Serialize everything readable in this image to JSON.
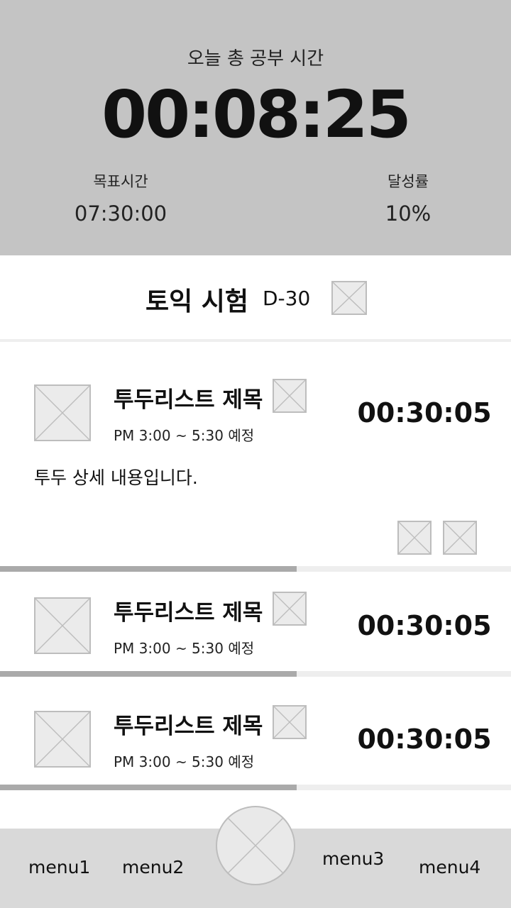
{
  "header": {
    "total_label": "오늘 총 공부 시간",
    "total_time": "00:08:25",
    "goal_label": "목표시간",
    "goal_value": "07:30:00",
    "rate_label": "달성률",
    "rate_value": "10%"
  },
  "exam": {
    "title": "토익 시험",
    "dday": "D-30"
  },
  "todos": [
    {
      "title": "투두리스트 제목",
      "time": "PM 3:00 ~ 5:30 예정",
      "timer": "00:30:05",
      "detail": "투두 상세 내용입니다.",
      "progress": 0.58
    },
    {
      "title": "투두리스트 제목",
      "time": "PM 3:00 ~ 5:30 예정",
      "timer": "00:30:05",
      "progress": 0.58
    },
    {
      "title": "투두리스트 제목",
      "time": "PM 3:00 ~ 5:30 예정",
      "timer": "00:30:05",
      "progress": 0.58
    }
  ],
  "nav": {
    "menu1": "menu1",
    "menu2": "menu2",
    "menu3": "menu3",
    "menu4": "menu4"
  },
  "colors": {
    "header_bg": "#c4c4c4",
    "nav_bg": "#d9d9d9",
    "progress_fill": "#aaaaaa",
    "progress_track": "#eeeeee",
    "placeholder": "#ebebeb"
  }
}
